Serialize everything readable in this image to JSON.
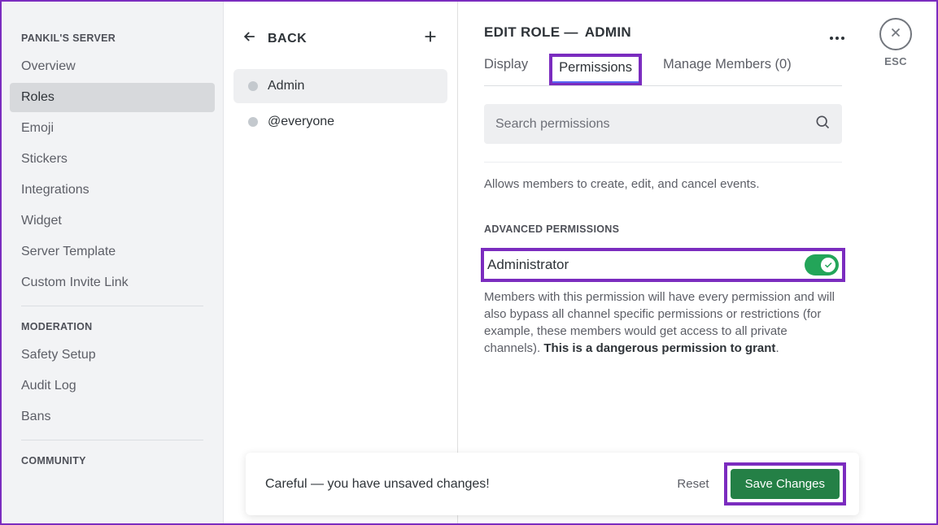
{
  "sidebar": {
    "server_section": "PANKIL'S SERVER",
    "items_server": [
      "Overview",
      "Roles",
      "Emoji",
      "Stickers",
      "Integrations",
      "Widget",
      "Server Template",
      "Custom Invite Link"
    ],
    "moderation_section": "MODERATION",
    "items_moderation": [
      "Safety Setup",
      "Audit Log",
      "Bans"
    ],
    "community_section": "COMMUNITY",
    "active": "Roles"
  },
  "roles_column": {
    "back_label": "BACK",
    "roles": [
      {
        "name": "Admin",
        "active": true
      },
      {
        "name": "@everyone",
        "active": false
      }
    ]
  },
  "main": {
    "title_prefix": "EDIT ROLE —",
    "title_role": "ADMIN",
    "esc_label": "ESC",
    "tabs": {
      "display": "Display",
      "permissions": "Permissions",
      "members": "Manage Members (0)",
      "active": "Permissions"
    },
    "search_placeholder": "Search permissions",
    "prior_desc": "Allows members to create, edit, and cancel events.",
    "section_label": "ADVANCED PERMISSIONS",
    "admin_perm": {
      "name": "Administrator",
      "enabled": true,
      "desc_plain": "Members with this permission will have every permission and will also bypass all channel specific permissions or restrictions (for example, these members would get access to all private channels). ",
      "desc_bold": "This is a dangerous permission to grant",
      "desc_tail": "."
    }
  },
  "unsaved": {
    "text": "Careful — you have unsaved changes!",
    "reset": "Reset",
    "save": "Save Changes"
  }
}
